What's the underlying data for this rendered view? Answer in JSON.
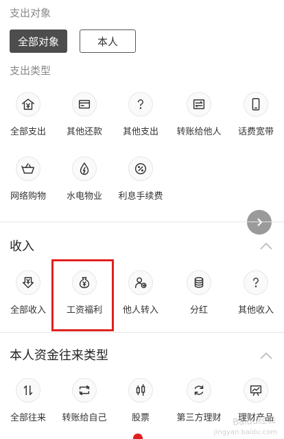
{
  "spend_target": {
    "label": "支出对象",
    "chips": [
      {
        "label": "全部对象",
        "active": true
      },
      {
        "label": "本人",
        "active": false
      }
    ]
  },
  "spend_type": {
    "label": "支出类型",
    "items": [
      {
        "label": "全部支出",
        "icon": "house-yen-icon"
      },
      {
        "label": "其他还款",
        "icon": "card-icon"
      },
      {
        "label": "其他支出",
        "icon": "question-icon"
      },
      {
        "label": "转账给他人",
        "icon": "transfer-icon"
      },
      {
        "label": "话费宽带",
        "icon": "phone-icon"
      },
      {
        "label": "网络购物",
        "icon": "basket-icon"
      },
      {
        "label": "水电物业",
        "icon": "drop-bolt-icon"
      },
      {
        "label": "利息手续费",
        "icon": "percent-icon"
      }
    ]
  },
  "income": {
    "title": "收入",
    "items": [
      {
        "label": "全部收入",
        "icon": "download-yen-icon"
      },
      {
        "label": "工资福利",
        "icon": "money-bag-icon"
      },
      {
        "label": "他人转入",
        "icon": "user-in-icon"
      },
      {
        "label": "分红",
        "icon": "coins-icon"
      },
      {
        "label": "其他收入",
        "icon": "question-icon"
      }
    ]
  },
  "own_funds": {
    "title": "本人资金往来类型",
    "items": [
      {
        "label": "全部往来",
        "icon": "arrows-updown-icon"
      },
      {
        "label": "转账给自己",
        "icon": "loop-icon"
      },
      {
        "label": "股票",
        "icon": "candlestick-icon"
      },
      {
        "label": "第三方理财",
        "icon": "circle-refresh-icon"
      },
      {
        "label": "理财产品",
        "icon": "chart-board-icon"
      }
    ]
  },
  "watermark": {
    "text": "Baidu经验",
    "sub": "jingyan.baidu.com"
  },
  "colors": {
    "highlight": "#e02020",
    "chip_active_bg": "#4d4d4d"
  }
}
